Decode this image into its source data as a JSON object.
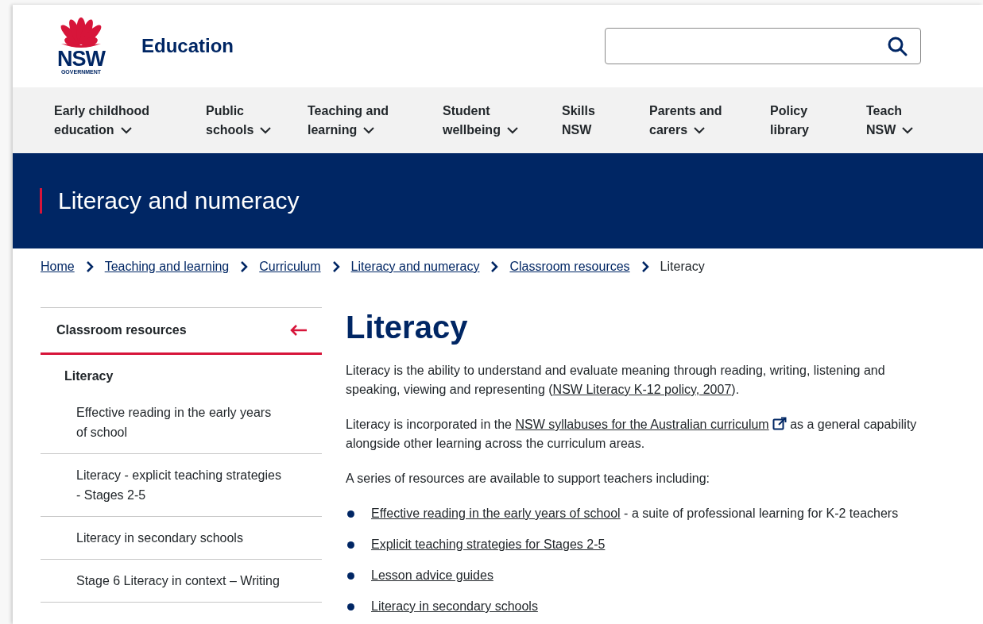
{
  "header": {
    "logo": {
      "wordmark": "NSW",
      "subtitle": "GOVERNMENT"
    },
    "site_name": "Education"
  },
  "nav": [
    {
      "label": "Early childhood education",
      "has_menu": true
    },
    {
      "label": "Public schools",
      "has_menu": true
    },
    {
      "label": "Teaching and learning",
      "has_menu": true
    },
    {
      "label": "Student wellbeing",
      "has_menu": true
    },
    {
      "label": "Skills NSW",
      "has_menu": false
    },
    {
      "label": "Parents and carers",
      "has_menu": true
    },
    {
      "label": "Policy library",
      "has_menu": false
    },
    {
      "label": "Teach NSW",
      "has_menu": true
    }
  ],
  "banner": {
    "title": "Literacy and numeracy"
  },
  "breadcrumb": [
    {
      "label": "Home",
      "current": false
    },
    {
      "label": "Teaching and learning",
      "current": false
    },
    {
      "label": "Curriculum",
      "current": false
    },
    {
      "label": "Literacy and numeracy",
      "current": false
    },
    {
      "label": "Classroom resources",
      "current": false
    },
    {
      "label": "Literacy",
      "current": true
    }
  ],
  "sidebar": {
    "title": "Classroom resources",
    "items": [
      {
        "label": "Literacy",
        "children": [
          {
            "label": "Effective reading in the early years of school"
          },
          {
            "label": "Literacy - explicit teaching strategies - Stages 2-5"
          },
          {
            "label": "Literacy in secondary schools"
          },
          {
            "label": "Stage 6 Literacy in context – Writing"
          }
        ]
      }
    ]
  },
  "content": {
    "heading": "Literacy",
    "paragraphs": [
      {
        "parts": [
          {
            "kind": "text",
            "text": "Literacy is the ability to understand and evaluate meaning through reading, writing, listening and speaking, viewing and representing ("
          },
          {
            "kind": "link",
            "text": "NSW Literacy K-12 policy, 2007",
            "external": false
          },
          {
            "kind": "text",
            "text": ")."
          }
        ]
      },
      {
        "parts": [
          {
            "kind": "text",
            "text": "Literacy is incorporated in the "
          },
          {
            "kind": "link",
            "text": "NSW syllabuses for the Australian curriculum",
            "external": true
          },
          {
            "kind": "text",
            "text": " as a general capability alongside other learning across the curriculum areas."
          }
        ]
      },
      {
        "parts": [
          {
            "kind": "text",
            "text": "A series of resources are available to support teachers including:"
          }
        ]
      }
    ],
    "bullets": [
      {
        "link": "Effective reading in the early years of school",
        "suffix": " - a suite of professional learning for K-2 teachers"
      },
      {
        "link": "Explicit teaching strategies for Stages 2-5"
      },
      {
        "link": "Lesson advice guides"
      },
      {
        "link": "Literacy in secondary schools"
      }
    ]
  }
}
